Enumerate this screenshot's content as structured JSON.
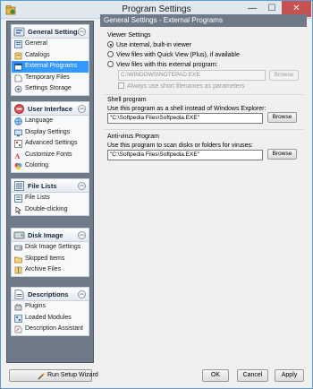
{
  "window": {
    "title": "Program Settings",
    "minimize_glyph": "—",
    "maximize_glyph": "☐",
    "close_glyph": "✕"
  },
  "sidebar": {
    "groups": [
      {
        "label": "General Settings",
        "icon": "general-settings-icon",
        "items": [
          {
            "label": "General",
            "icon": "general-icon",
            "selected": false
          },
          {
            "label": "Catalogs",
            "icon": "catalogs-icon",
            "selected": false
          },
          {
            "label": "External Programs",
            "icon": "external-programs-icon",
            "selected": true
          },
          {
            "label": "Temporary Files",
            "icon": "temporary-files-icon",
            "selected": false
          },
          {
            "label": "Settings Storage",
            "icon": "settings-storage-icon",
            "selected": false
          }
        ]
      },
      {
        "label": "User Interface",
        "icon": "user-interface-icon",
        "items": [
          {
            "label": "Language",
            "icon": "language-icon",
            "selected": false
          },
          {
            "label": "Display Settings",
            "icon": "display-settings-icon",
            "selected": false
          },
          {
            "label": "Advanced Settings",
            "icon": "advanced-settings-icon",
            "selected": false
          },
          {
            "label": "Customize Fonts",
            "icon": "customize-fonts-icon",
            "selected": false
          },
          {
            "label": "Coloring",
            "icon": "coloring-icon",
            "selected": false
          }
        ]
      },
      {
        "label": "File Lists",
        "icon": "file-lists-icon",
        "items": [
          {
            "label": "File Lists",
            "icon": "file-lists-item-icon",
            "selected": false
          },
          {
            "label": "Double-clicking",
            "icon": "double-clicking-icon",
            "selected": false
          }
        ]
      },
      {
        "label": "Disk Image",
        "icon": "disk-image-icon",
        "items": [
          {
            "label": "Disk Image Settings",
            "icon": "disk-image-settings-icon",
            "selected": false
          },
          {
            "label": "Skipped Items",
            "icon": "skipped-items-icon",
            "selected": false
          },
          {
            "label": "Archive Files",
            "icon": "archive-files-icon",
            "selected": false
          }
        ]
      },
      {
        "label": "Descriptions",
        "icon": "descriptions-icon",
        "items": [
          {
            "label": "Plugins",
            "icon": "plugins-icon",
            "selected": false
          },
          {
            "label": "Loaded Modules",
            "icon": "loaded-modules-icon",
            "selected": false
          },
          {
            "label": "Description Assistant",
            "icon": "description-assistant-icon",
            "selected": false
          }
        ]
      }
    ]
  },
  "content": {
    "header": "General Settings - External Programs",
    "viewer": {
      "label": "Viewer Settings",
      "options": [
        {
          "label": "Use internal, built-in viewer",
          "checked": true
        },
        {
          "label": "View files with Quick View (Plus), if available",
          "checked": false
        },
        {
          "label": "View files with this external program:",
          "checked": false
        }
      ],
      "program_value": "C:\\WINDOWS\\NOTEPAD.EXE",
      "browse_label": "Browse",
      "short_names_label": "Always use short filenames as parameters"
    },
    "shell": {
      "label": "Shell program",
      "description": "Use this program as a shell instead of Windows Explorer:",
      "value": "\"C:\\Softpedia Files\\Softpedia.EXE\"",
      "browse_label": "Browse"
    },
    "antivirus": {
      "label": "Anti-virus Program",
      "description": "Use this program to scan disks or folders for viruses:",
      "value": "\"C:\\Softpedia Files\\Softpedia.EXE\"",
      "browse_label": "Browse"
    }
  },
  "footer": {
    "wizard_label": "Run Setup Wizard",
    "ok_label": "OK",
    "cancel_label": "Cancel",
    "apply_label": "Apply"
  },
  "colors": {
    "sidebar_bg": "#6f7a89",
    "selection": "#3399ff",
    "close_button": "#c75050"
  }
}
